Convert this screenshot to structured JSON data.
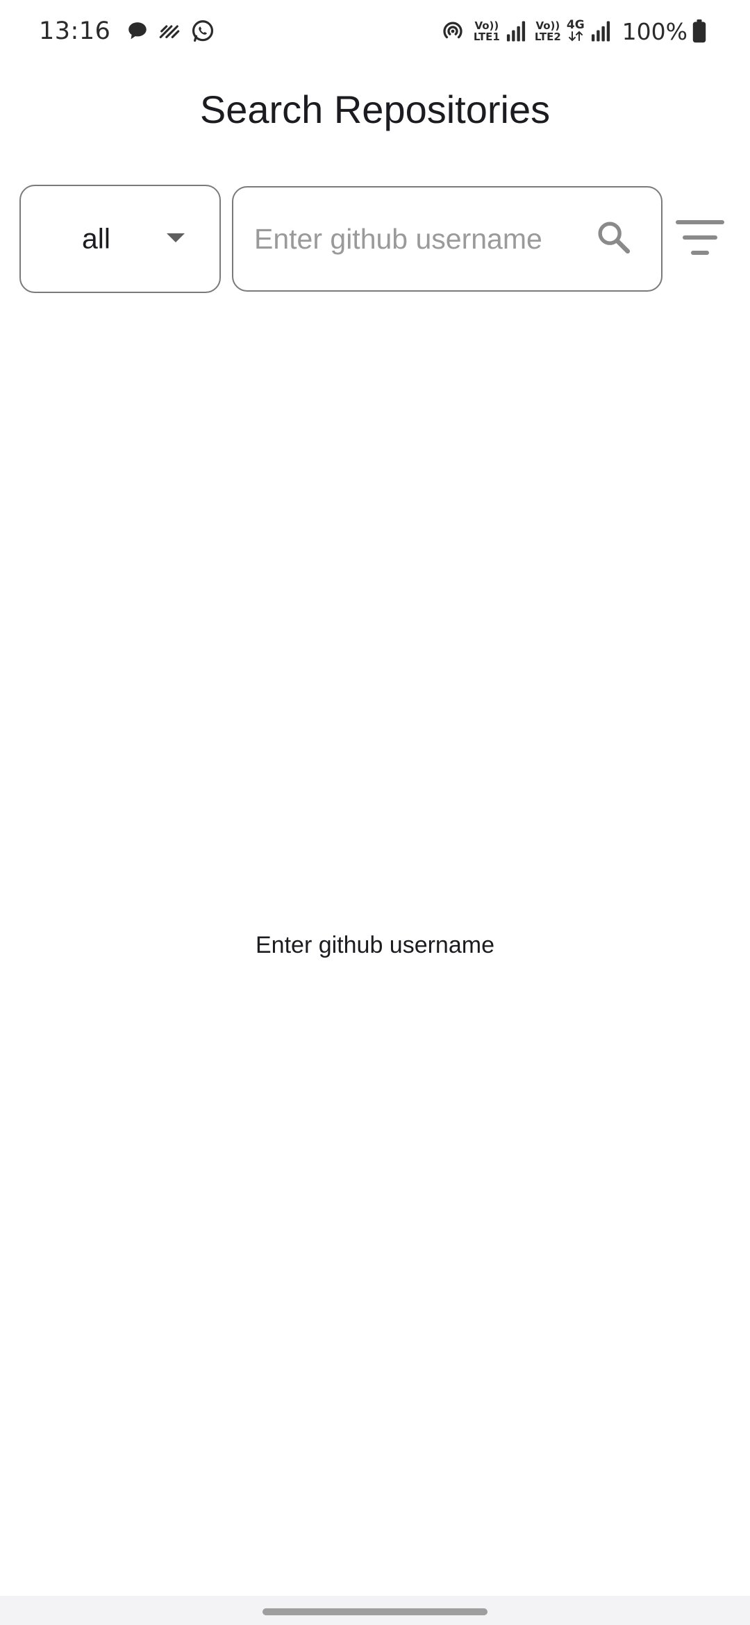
{
  "status_bar": {
    "time": "13:16",
    "icons_left": [
      "message-icon",
      "diagonal-lines-icon",
      "whatsapp-icon"
    ],
    "icons_right": [
      "hotspot-icon",
      "signal-icon",
      "signal-icon",
      "battery-icon"
    ],
    "net1_top": "Vo))",
    "net1_bottom": "LTE1",
    "net2_top": "Vo))",
    "net2_bottom": "LTE2",
    "net2_type": "4G",
    "battery": "100%"
  },
  "app_bar": {
    "title": "Search Repositories"
  },
  "controls": {
    "type_select": {
      "value": "all"
    },
    "search": {
      "placeholder": "Enter github username",
      "value": ""
    },
    "filter_icon": "filter-icon"
  },
  "empty_state": {
    "message": "Enter github username"
  },
  "colors": {
    "outline": "#7a7a7a",
    "icon_gray": "#8a8a8a",
    "text": "#1c1b1f",
    "placeholder": "#9a9a9a",
    "nav_bg": "#f3f3f6"
  }
}
